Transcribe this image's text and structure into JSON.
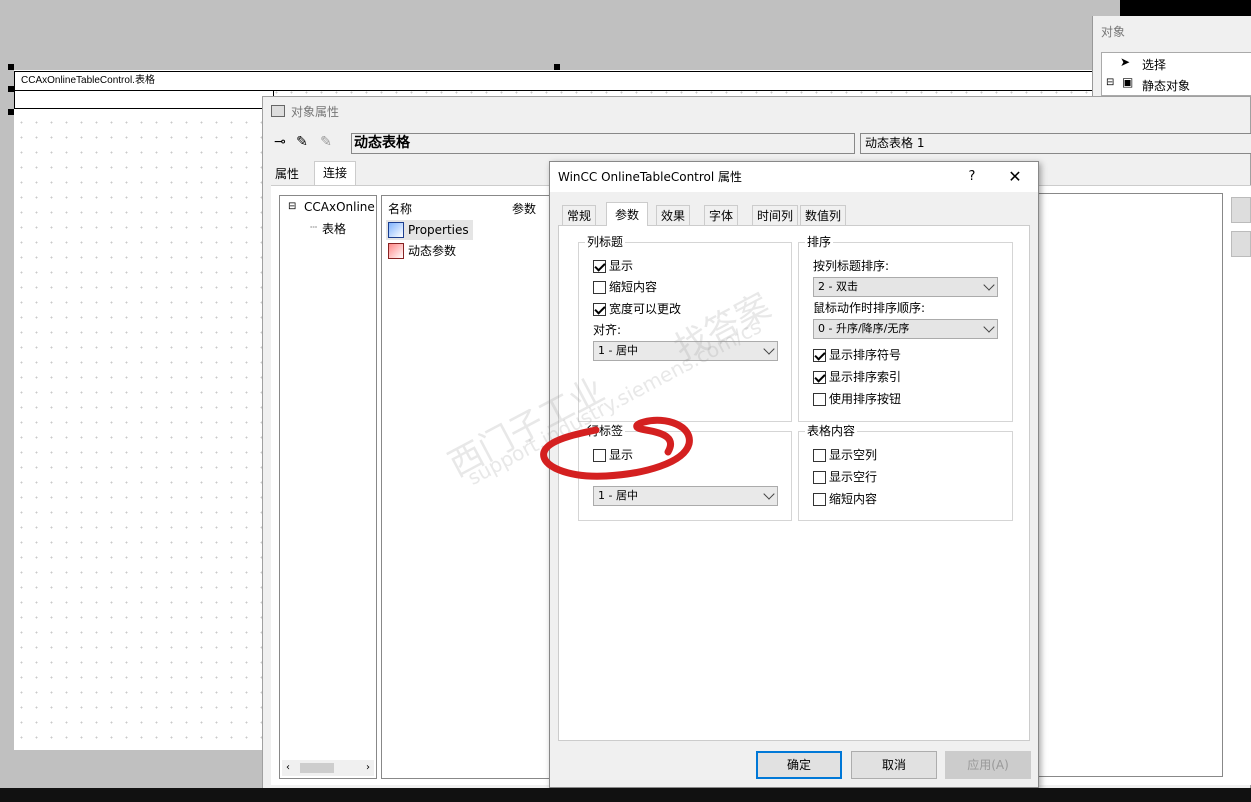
{
  "canvas": {
    "table_header_label": "CCAxOnlineTableControl.表格"
  },
  "object_window": {
    "title": "对象",
    "items": [
      {
        "label": "选择"
      },
      {
        "label": "静态对象"
      }
    ]
  },
  "props_window": {
    "title": "对象属性",
    "object_name": "动态表格",
    "object_instance": "动态表格 1",
    "tabs": [
      {
        "label": "属性"
      },
      {
        "label": "连接"
      }
    ],
    "tree": {
      "root": "CCAxOnline",
      "child": "表格"
    },
    "list": {
      "col_name": "名称",
      "col_param": "参数",
      "items": [
        {
          "label": "Properties"
        },
        {
          "label": "动态参数"
        }
      ]
    }
  },
  "dialog": {
    "title": "WinCC OnlineTableControl 属性",
    "help": "?",
    "close": "✕",
    "tabs": [
      {
        "label": "常规"
      },
      {
        "label": "参数"
      },
      {
        "label": "效果"
      },
      {
        "label": "字体"
      },
      {
        "label": "时间列"
      },
      {
        "label": "数值列"
      }
    ],
    "column_header": {
      "label": "列标题",
      "show": "显示",
      "shorten": "缩短内容",
      "width_changeable": "宽度可以更改",
      "align_label": "对齐:",
      "align_value": "1 - 居中"
    },
    "sort": {
      "label": "排序",
      "by_header_label": "按列标题排序:",
      "by_header_value": "2 - 双击",
      "mouse_order_label": "鼠标动作时排序顺序:",
      "mouse_order_value": "0 - 升序/降序/无序",
      "show_sort_symbol": "显示排序符号",
      "show_sort_index": "显示排序索引",
      "use_sort_button": "使用排序按钮"
    },
    "row_header": {
      "label": "行标签",
      "show": "显示",
      "align_value": "1 - 居中"
    },
    "table_content": {
      "label": "表格内容",
      "show_empty_cols": "显示空列",
      "show_empty_rows": "显示空行",
      "shorten": "缩短内容"
    },
    "buttons": {
      "ok": "确定",
      "cancel": "取消",
      "apply": "应用(A)"
    },
    "states": {
      "col_show": true,
      "col_shorten": false,
      "col_width": true,
      "sort_symbol": true,
      "sort_index": true,
      "sort_button": false,
      "row_show": false,
      "empty_cols": false,
      "empty_rows": false,
      "content_shorten": false
    }
  },
  "watermark": {
    "line1": "西门子工业",
    "line2": "找答案",
    "line3": "support.industry.siemens.com/cs"
  },
  "colors": {
    "annotation_circle": "#d42020",
    "primary_button_border": "#0078d7"
  }
}
